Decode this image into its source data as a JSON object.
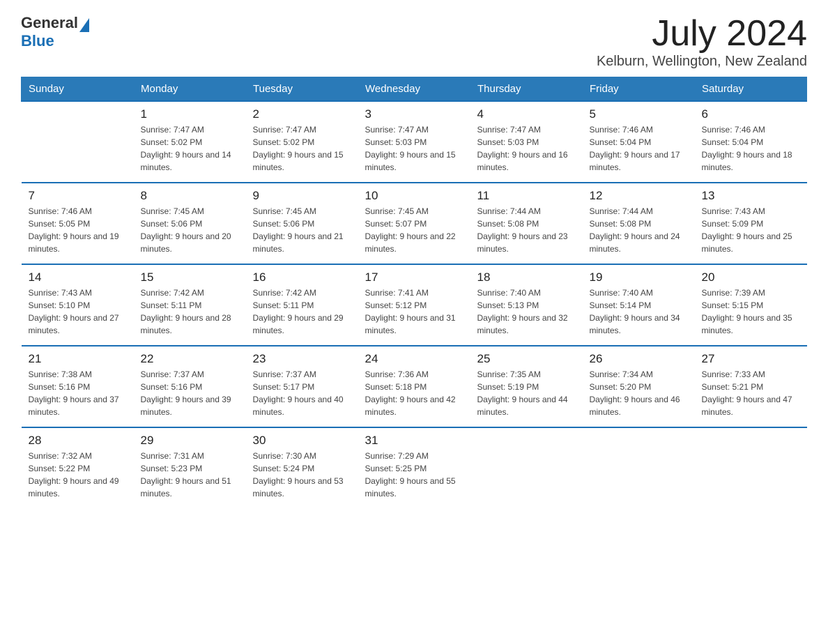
{
  "header": {
    "logo_general": "General",
    "logo_blue": "Blue",
    "month_title": "July 2024",
    "location": "Kelburn, Wellington, New Zealand"
  },
  "weekdays": [
    "Sunday",
    "Monday",
    "Tuesday",
    "Wednesday",
    "Thursday",
    "Friday",
    "Saturday"
  ],
  "weeks": [
    [
      {
        "day": "",
        "sunrise": "",
        "sunset": "",
        "daylight": ""
      },
      {
        "day": "1",
        "sunrise": "Sunrise: 7:47 AM",
        "sunset": "Sunset: 5:02 PM",
        "daylight": "Daylight: 9 hours and 14 minutes."
      },
      {
        "day": "2",
        "sunrise": "Sunrise: 7:47 AM",
        "sunset": "Sunset: 5:02 PM",
        "daylight": "Daylight: 9 hours and 15 minutes."
      },
      {
        "day": "3",
        "sunrise": "Sunrise: 7:47 AM",
        "sunset": "Sunset: 5:03 PM",
        "daylight": "Daylight: 9 hours and 15 minutes."
      },
      {
        "day": "4",
        "sunrise": "Sunrise: 7:47 AM",
        "sunset": "Sunset: 5:03 PM",
        "daylight": "Daylight: 9 hours and 16 minutes."
      },
      {
        "day": "5",
        "sunrise": "Sunrise: 7:46 AM",
        "sunset": "Sunset: 5:04 PM",
        "daylight": "Daylight: 9 hours and 17 minutes."
      },
      {
        "day": "6",
        "sunrise": "Sunrise: 7:46 AM",
        "sunset": "Sunset: 5:04 PM",
        "daylight": "Daylight: 9 hours and 18 minutes."
      }
    ],
    [
      {
        "day": "7",
        "sunrise": "Sunrise: 7:46 AM",
        "sunset": "Sunset: 5:05 PM",
        "daylight": "Daylight: 9 hours and 19 minutes."
      },
      {
        "day": "8",
        "sunrise": "Sunrise: 7:45 AM",
        "sunset": "Sunset: 5:06 PM",
        "daylight": "Daylight: 9 hours and 20 minutes."
      },
      {
        "day": "9",
        "sunrise": "Sunrise: 7:45 AM",
        "sunset": "Sunset: 5:06 PM",
        "daylight": "Daylight: 9 hours and 21 minutes."
      },
      {
        "day": "10",
        "sunrise": "Sunrise: 7:45 AM",
        "sunset": "Sunset: 5:07 PM",
        "daylight": "Daylight: 9 hours and 22 minutes."
      },
      {
        "day": "11",
        "sunrise": "Sunrise: 7:44 AM",
        "sunset": "Sunset: 5:08 PM",
        "daylight": "Daylight: 9 hours and 23 minutes."
      },
      {
        "day": "12",
        "sunrise": "Sunrise: 7:44 AM",
        "sunset": "Sunset: 5:08 PM",
        "daylight": "Daylight: 9 hours and 24 minutes."
      },
      {
        "day": "13",
        "sunrise": "Sunrise: 7:43 AM",
        "sunset": "Sunset: 5:09 PM",
        "daylight": "Daylight: 9 hours and 25 minutes."
      }
    ],
    [
      {
        "day": "14",
        "sunrise": "Sunrise: 7:43 AM",
        "sunset": "Sunset: 5:10 PM",
        "daylight": "Daylight: 9 hours and 27 minutes."
      },
      {
        "day": "15",
        "sunrise": "Sunrise: 7:42 AM",
        "sunset": "Sunset: 5:11 PM",
        "daylight": "Daylight: 9 hours and 28 minutes."
      },
      {
        "day": "16",
        "sunrise": "Sunrise: 7:42 AM",
        "sunset": "Sunset: 5:11 PM",
        "daylight": "Daylight: 9 hours and 29 minutes."
      },
      {
        "day": "17",
        "sunrise": "Sunrise: 7:41 AM",
        "sunset": "Sunset: 5:12 PM",
        "daylight": "Daylight: 9 hours and 31 minutes."
      },
      {
        "day": "18",
        "sunrise": "Sunrise: 7:40 AM",
        "sunset": "Sunset: 5:13 PM",
        "daylight": "Daylight: 9 hours and 32 minutes."
      },
      {
        "day": "19",
        "sunrise": "Sunrise: 7:40 AM",
        "sunset": "Sunset: 5:14 PM",
        "daylight": "Daylight: 9 hours and 34 minutes."
      },
      {
        "day": "20",
        "sunrise": "Sunrise: 7:39 AM",
        "sunset": "Sunset: 5:15 PM",
        "daylight": "Daylight: 9 hours and 35 minutes."
      }
    ],
    [
      {
        "day": "21",
        "sunrise": "Sunrise: 7:38 AM",
        "sunset": "Sunset: 5:16 PM",
        "daylight": "Daylight: 9 hours and 37 minutes."
      },
      {
        "day": "22",
        "sunrise": "Sunrise: 7:37 AM",
        "sunset": "Sunset: 5:16 PM",
        "daylight": "Daylight: 9 hours and 39 minutes."
      },
      {
        "day": "23",
        "sunrise": "Sunrise: 7:37 AM",
        "sunset": "Sunset: 5:17 PM",
        "daylight": "Daylight: 9 hours and 40 minutes."
      },
      {
        "day": "24",
        "sunrise": "Sunrise: 7:36 AM",
        "sunset": "Sunset: 5:18 PM",
        "daylight": "Daylight: 9 hours and 42 minutes."
      },
      {
        "day": "25",
        "sunrise": "Sunrise: 7:35 AM",
        "sunset": "Sunset: 5:19 PM",
        "daylight": "Daylight: 9 hours and 44 minutes."
      },
      {
        "day": "26",
        "sunrise": "Sunrise: 7:34 AM",
        "sunset": "Sunset: 5:20 PM",
        "daylight": "Daylight: 9 hours and 46 minutes."
      },
      {
        "day": "27",
        "sunrise": "Sunrise: 7:33 AM",
        "sunset": "Sunset: 5:21 PM",
        "daylight": "Daylight: 9 hours and 47 minutes."
      }
    ],
    [
      {
        "day": "28",
        "sunrise": "Sunrise: 7:32 AM",
        "sunset": "Sunset: 5:22 PM",
        "daylight": "Daylight: 9 hours and 49 minutes."
      },
      {
        "day": "29",
        "sunrise": "Sunrise: 7:31 AM",
        "sunset": "Sunset: 5:23 PM",
        "daylight": "Daylight: 9 hours and 51 minutes."
      },
      {
        "day": "30",
        "sunrise": "Sunrise: 7:30 AM",
        "sunset": "Sunset: 5:24 PM",
        "daylight": "Daylight: 9 hours and 53 minutes."
      },
      {
        "day": "31",
        "sunrise": "Sunrise: 7:29 AM",
        "sunset": "Sunset: 5:25 PM",
        "daylight": "Daylight: 9 hours and 55 minutes."
      },
      {
        "day": "",
        "sunrise": "",
        "sunset": "",
        "daylight": ""
      },
      {
        "day": "",
        "sunrise": "",
        "sunset": "",
        "daylight": ""
      },
      {
        "day": "",
        "sunrise": "",
        "sunset": "",
        "daylight": ""
      }
    ]
  ]
}
